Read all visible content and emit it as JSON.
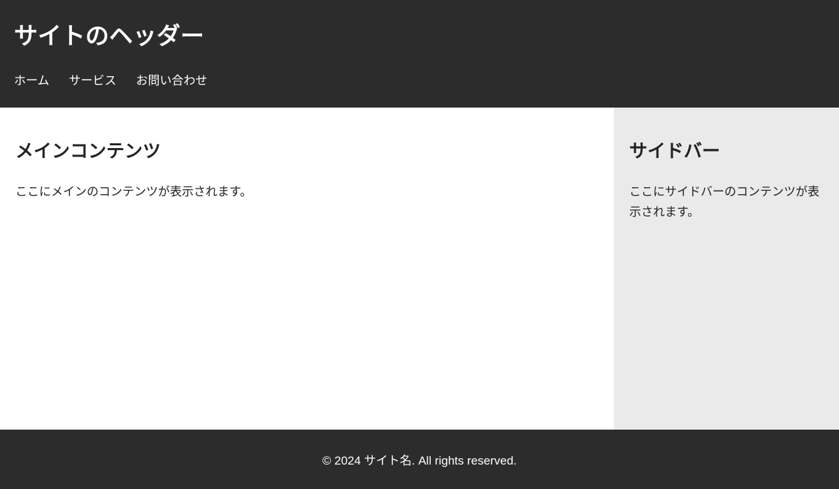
{
  "header": {
    "title": "サイトのヘッダー",
    "nav": {
      "items": [
        {
          "label": "ホーム"
        },
        {
          "label": "サービス"
        },
        {
          "label": "お問い合わせ"
        }
      ]
    }
  },
  "main": {
    "heading": "メインコンテンツ",
    "body": "ここにメインのコンテンツが表示されます。"
  },
  "sidebar": {
    "heading": "サイドバー",
    "body": "ここにサイドバーのコンテンツが表示されます。"
  },
  "footer": {
    "text": "© 2024 サイト名. All rights reserved."
  }
}
